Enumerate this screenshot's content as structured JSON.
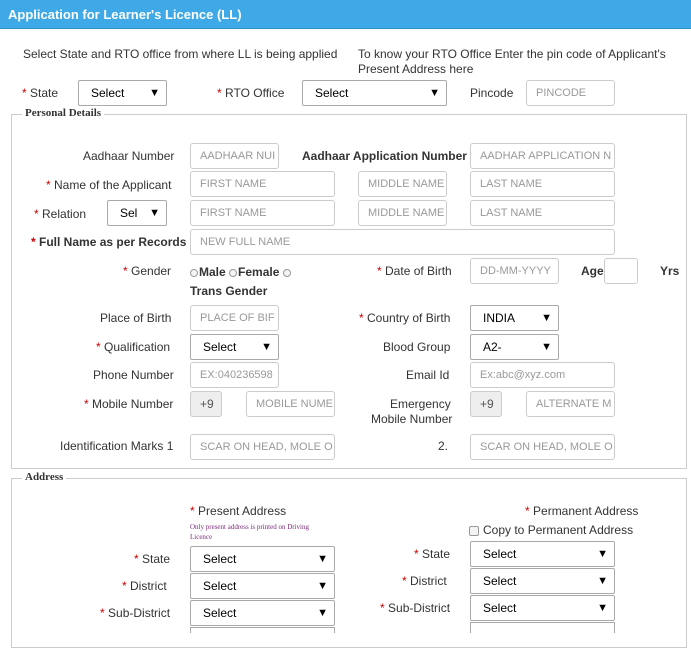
{
  "header": {
    "title": "Application for Learner's Licence (LL)"
  },
  "intro": {
    "left_text": "Select State and RTO office from where LL is being applied",
    "right_text_1": "To know your RTO Office Enter the pin code of Applicant's",
    "right_text_2": "Present Address here"
  },
  "rto": {
    "state_label": "State",
    "state_value": "Select",
    "rto_label": "RTO Office",
    "rto_value": "Select",
    "pincode_label": "Pincode",
    "pincode_placeholder": "PINCODE"
  },
  "required_mark": "*",
  "personal": {
    "legend": "Personal Details",
    "aadhaar_label": "Aadhaar Number",
    "aadhaar_placeholder": "AADHAAR NUI",
    "aadhaar_app_label": "Aadhaar Application Number",
    "aadhaar_app_placeholder": "AADHAR APPLICATION N",
    "name_label": "Name of the Applicant",
    "first_name": "FIRST NAME",
    "middle_name": "MIDDLE NAME",
    "last_name": "LAST NAME",
    "relation_label": "Relation",
    "relation_value": "Sel",
    "fullname_label": "Full Name as per Records",
    "fullname_placeholder": "NEW FULL NAME",
    "gender_label": "Gender",
    "gender_male": "Male",
    "gender_female": "Female",
    "gender_trans": "Trans Gender",
    "dob_label": "Date of Birth",
    "dob_placeholder": "DD-MM-YYYY",
    "age_label": "Age",
    "yrs_label": "Yrs",
    "pob_label": "Place of Birth",
    "pob_placeholder": "PLACE OF BIF",
    "country_label": "Country of Birth",
    "country_value": "INDIA",
    "qual_label": "Qualification",
    "qual_value": "Select",
    "blood_label": "Blood Group",
    "blood_value": "A2-",
    "phone_label": "Phone Number",
    "phone_placeholder": "EX:040236598",
    "email_label": "Email Id",
    "email_placeholder": "Ex:abc@xyz.com",
    "mobile_label": "Mobile Number",
    "mobile_prefix": "+9",
    "mobile_placeholder": "MOBILE NUME",
    "emergency_label_1": "Emergency",
    "emergency_label_2": "Mobile Number",
    "emergency_prefix": "+9",
    "emergency_placeholder": "ALTERNATE M",
    "idmarks_label": "Identification Marks 1",
    "idmarks1_placeholder": "SCAR ON HEAD, MOLE O",
    "idmarks2_label": "2.",
    "idmarks2_placeholder": "SCAR ON HEAD, MOLE O"
  },
  "address": {
    "legend": "Address",
    "present_label": "Present Address",
    "present_note_1": "Only present address is printed on Driving",
    "present_note_2": "Licence",
    "permanent_label": "Permanent Address",
    "copy_label": "Copy to Permanent Address",
    "state_label": "State",
    "district_label": "District",
    "subdistrict_label": "Sub-District",
    "select_value": "Select"
  }
}
